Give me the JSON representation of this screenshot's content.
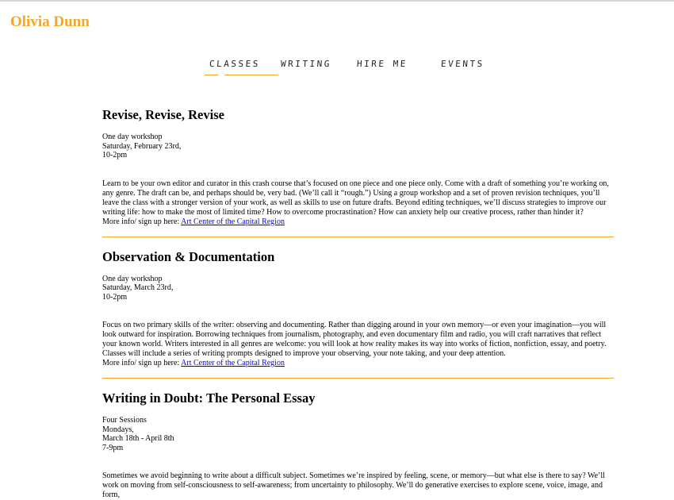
{
  "site": {
    "title": "Olivia Dunn"
  },
  "nav": {
    "items": [
      {
        "label": "Classes"
      },
      {
        "label": "Writing"
      },
      {
        "label": "Hire me"
      },
      {
        "label": "Events"
      }
    ]
  },
  "accent_color": "#f5a623",
  "classes": [
    {
      "title": "Revise, Revise, Revise",
      "meta": [
        "One day workshop",
        "Saturday, February 23rd,",
        "10-2pm"
      ],
      "description": "Learn to be your own editor and curator in this crash course that’s focused on one piece and one piece only. Come with a draft of something you’re working on, any genre. The draft can be, and perhaps should be, very bad. (We’ll call it “rough.”) Using a group workshop and a set of proven revision techniques, you’ll leave the class with a stronger version of your work, as well as skills to use on future drafts. Beyond editing techniques, we’ll discuss strategies to improve our writing life: how to make the most of limited time? How to overcome procrastination? How can anxiety help our creative process, rather than hinder it?",
      "more_prefix": "More info/ sign up here: ",
      "link_text": "Art Center of the Capital Region"
    },
    {
      "title": "Observation & Documentation",
      "meta": [
        "One day workshop",
        "Saturday, March 23rd,",
        "10-2pm"
      ],
      "description": "Focus on two primary skills of the writer: observing and documenting. Rather than digging around in your own memory—or even your imagination—you will look outward for inspiration. Borrowing techniques from journalism, photography, and even documentary film and radio, you will craft narratives that reflect your known world. Writers interested in all genres are welcome: you will look at how reality makes its way into works of fiction, nonfiction, essay, and poetry. Classes will include a series of writing prompts designed to improve your observing, your note taking, and your deep attention.",
      "more_prefix": "More info/ sign up here: ",
      "link_text": "Art Center of the Capital Region"
    },
    {
      "title": "Writing in Doubt: The Personal Essay",
      "meta": [
        "Four Sessions",
        "Mondays,",
        "March 18th - April 8th",
        "7-9pm"
      ],
      "description": "Sometimes we avoid beginning to write about a difficult subject. Sometimes we’re inspired by feeling, scene, or memory—but what else is there to say? We’ll work on moving from self-consciousness to self-awareness; from uncertainty to philosophy. We’ll do generative exercises to explore scene, voice, image, and form,"
    }
  ]
}
